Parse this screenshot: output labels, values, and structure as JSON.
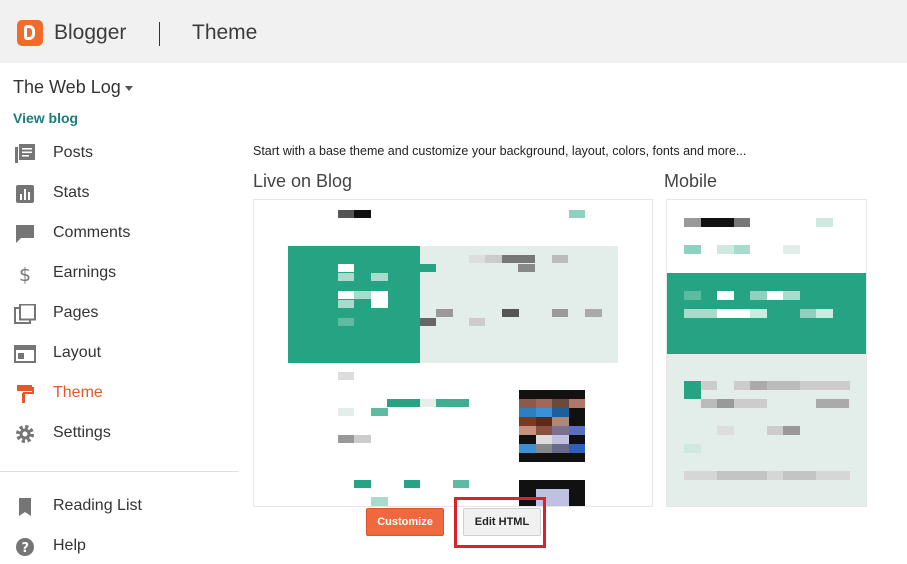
{
  "header": {
    "brand": "Blogger",
    "page_title": "Theme"
  },
  "blog": {
    "name": "The Web Log",
    "view_blog": "View blog"
  },
  "nav": {
    "posts": "Posts",
    "stats": "Stats",
    "comments": "Comments",
    "earnings": "Earnings",
    "pages": "Pages",
    "layout": "Layout",
    "theme": "Theme",
    "settings": "Settings",
    "reading_list": "Reading List",
    "help": "Help"
  },
  "main": {
    "intro": "Start with a base theme and customize your background, layout, colors, fonts and more...",
    "live_title": "Live on Blog",
    "mobile_title": "Mobile",
    "customize_label": "Customize",
    "edit_html_label": "Edit HTML"
  },
  "colors": {
    "accent": "#26a383",
    "brand": "#f26b2b",
    "active_nav": "#e4572e",
    "highlight": "#d8232a"
  }
}
